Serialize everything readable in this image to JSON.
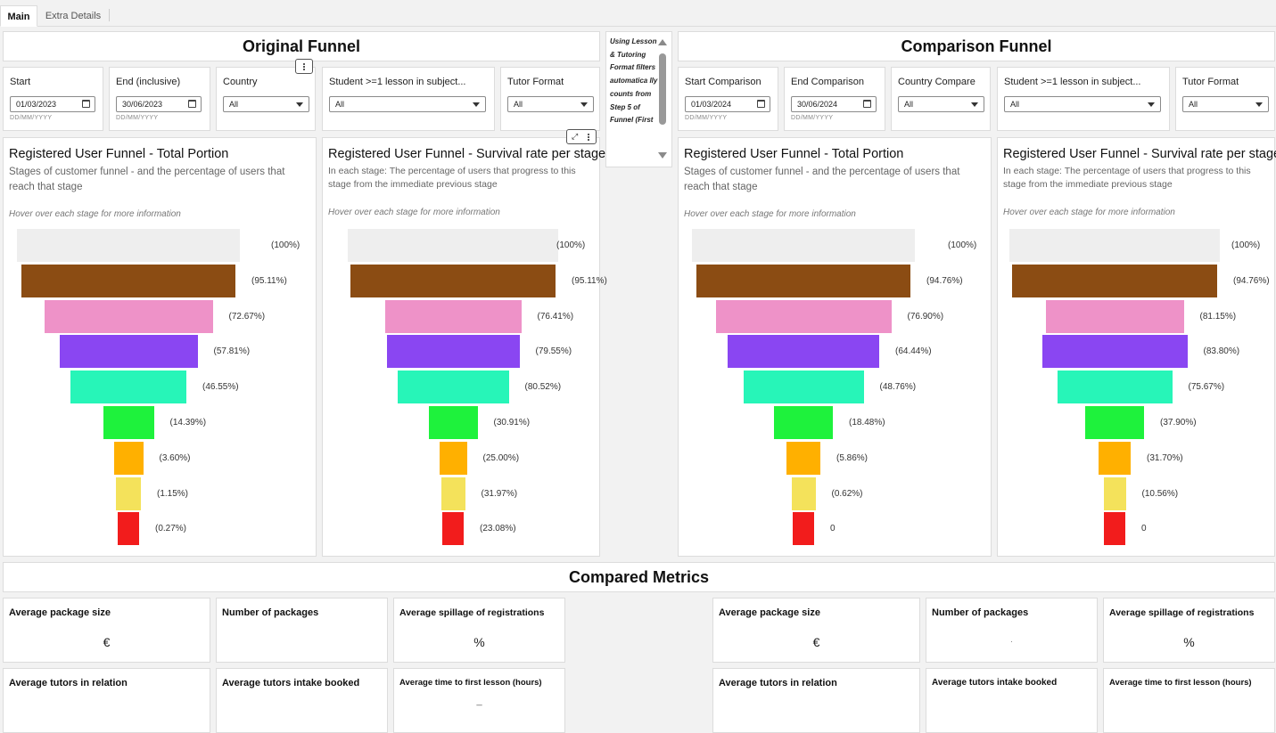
{
  "tabs": [
    {
      "label": "Main",
      "active": true
    },
    {
      "label": "Extra Details",
      "active": false
    }
  ],
  "original": {
    "title": "Original Funnel",
    "filters": {
      "start": {
        "label": "Start",
        "value": "01/03/2023",
        "hint": "DD/MM/YYYY"
      },
      "end": {
        "label": "End (inclusive)",
        "value": "30/06/2023",
        "hint": "DD/MM/YYYY"
      },
      "country": {
        "label": "Country",
        "value": "All"
      },
      "student": {
        "label": "Student >=1 lesson in subject...",
        "value": "All"
      },
      "tutor_format": {
        "label": "Tutor Format",
        "value": "All"
      }
    },
    "total_chart": {
      "title": "Registered User Funnel - Total Portion",
      "subtitle": "Stages of customer funnel - and the percentage of users that reach that stage",
      "hint": "Hover over each stage for more information"
    },
    "survival_chart": {
      "title": "Registered User Funnel - Survival rate per stage",
      "subtitle": "In each stage: The percentage of users that progress to this stage from the immediate previous stage",
      "hint": "Hover over each stage for more information"
    }
  },
  "comparison": {
    "title": "Comparison Funnel",
    "filters": {
      "start": {
        "label": "Start Comparison",
        "value": "01/03/2024",
        "hint": "DD/MM/YYYY"
      },
      "end": {
        "label": "End Comparison",
        "value": "30/06/2024",
        "hint": "DD/MM/YYYY"
      },
      "country": {
        "label": "Country Compare",
        "value": "All"
      },
      "student": {
        "label": "Student >=1 lesson in subject...",
        "value": "All"
      },
      "tutor_format": {
        "label": "Tutor Format",
        "value": "All"
      }
    },
    "total_chart": {
      "title": "Registered User Funnel - Total Portion",
      "subtitle": "Stages of customer funnel - and the percentage of users that reach that stage",
      "hint": "Hover over each stage for more information"
    },
    "survival_chart": {
      "title": "Registered User Funnel - Survival rate per stage",
      "subtitle": "In each stage: The percentage of users that progress to this stage from the immediate previous stage",
      "hint": "Hover over each stage for more information"
    }
  },
  "note": {
    "text": "Using Lesson & Tutoring Format filters automatica lly counts from Step 5 of Funnel (First"
  },
  "stage_colors": [
    "#eeeeee",
    "#8b4c13",
    "#ee92c8",
    "#8a46f2",
    "#27f5b8",
    "#1ef23c",
    "#ffb000",
    "#f4e25b",
    "#f21c1c"
  ],
  "chart_data": [
    {
      "type": "bar",
      "title": "Registered User Funnel - Total Portion",
      "labels": [
        "(100%)",
        "(95.11%)",
        "(72.67%)",
        "(57.81%)",
        "(46.55%)",
        "(14.39%)",
        "(3.60%)",
        "(1.15%)",
        "(0.27%)"
      ],
      "values": [
        100,
        95.11,
        72.67,
        57.81,
        46.55,
        14.39,
        3.6,
        1.15,
        0.27
      ]
    },
    {
      "type": "bar",
      "title": "Registered User Funnel - Survival rate per stage",
      "labels": [
        "(100%)",
        "(95.11%)",
        "(76.41%)",
        "(79.55%)",
        "(80.52%)",
        "(30.91%)",
        "(25.00%)",
        "(31.97%)",
        "(23.08%)"
      ],
      "values": [
        100,
        95.11,
        76.41,
        79.55,
        80.52,
        30.91,
        25.0,
        31.97,
        23.08
      ]
    },
    {
      "type": "bar",
      "title": "Registered User Funnel - Total Portion",
      "labels": [
        "(100%)",
        "(94.76%)",
        "(76.90%)",
        "(64.44%)",
        "(48.76%)",
        "(18.48%)",
        "(5.86%)",
        "(0.62%)",
        "0"
      ],
      "values": [
        100,
        94.76,
        76.9,
        64.44,
        48.76,
        18.48,
        5.86,
        0.62,
        0
      ]
    },
    {
      "type": "bar",
      "title": "Registered User Funnel - Survival rate per stage",
      "labels": [
        "(100%)",
        "(94.76%)",
        "(81.15%)",
        "(83.80%)",
        "(75.67%)",
        "(37.90%)",
        "(31.70%)",
        "(10.56%)",
        "0"
      ],
      "values": [
        100,
        94.76,
        81.15,
        83.8,
        75.67,
        37.9,
        31.7,
        10.56,
        0
      ]
    }
  ],
  "compared_metrics": {
    "title": "Compared Metrics",
    "left": {
      "avg_package_size": {
        "title": "Average package size",
        "value": "€"
      },
      "num_packages": {
        "title": "Number of packages",
        "value": ""
      },
      "avg_spillage": {
        "title": "Average spillage of registrations",
        "value": "%"
      },
      "avg_tutors_relation": {
        "title": "Average tutors in relation",
        "value": ""
      },
      "avg_tutors_intake": {
        "title": "Average tutors intake booked",
        "value": ""
      },
      "avg_time_first_lesson": {
        "title": "Average time to first lesson (hours)",
        "value": "_"
      }
    },
    "right": {
      "avg_package_size": {
        "title": "Average package size",
        "value": "€"
      },
      "num_packages": {
        "title": "Number of packages",
        "value": "."
      },
      "avg_spillage": {
        "title": "Average spillage of registrations",
        "value": "%"
      },
      "avg_tutors_relation": {
        "title": "Average tutors in relation",
        "value": ""
      },
      "avg_tutors_intake": {
        "title": "Average tutors intake booked",
        "value": ""
      },
      "avg_time_first_lesson": {
        "title": "Average time to first lesson (hours)",
        "value": ""
      }
    }
  }
}
